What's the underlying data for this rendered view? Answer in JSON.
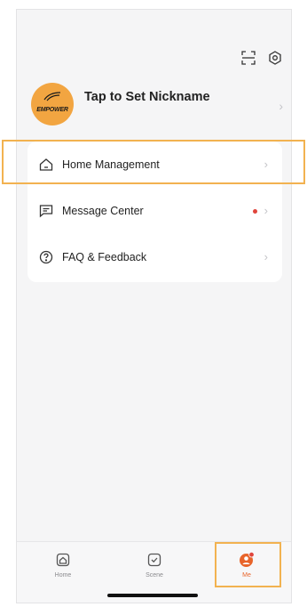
{
  "profile": {
    "nickname": "Tap to Set Nickname",
    "avatar_text": "EMPOWER"
  },
  "menu": {
    "items": [
      {
        "label": "Home Management",
        "icon": "house-icon"
      },
      {
        "label": "Message Center",
        "icon": "message-icon",
        "has_badge": true
      },
      {
        "label": "FAQ & Feedback",
        "icon": "question-circle-icon"
      }
    ]
  },
  "tabbar": {
    "tabs": [
      {
        "label": "Home",
        "icon": "home-tab-icon"
      },
      {
        "label": "Scene",
        "icon": "checkbox-tab-icon"
      },
      {
        "label": "Me",
        "icon": "user-tab-icon",
        "active": true
      }
    ]
  },
  "colors": {
    "accent": "#e8642a",
    "avatar": "#f2a541",
    "highlight": "#f2b250",
    "badge": "#e0443b"
  }
}
